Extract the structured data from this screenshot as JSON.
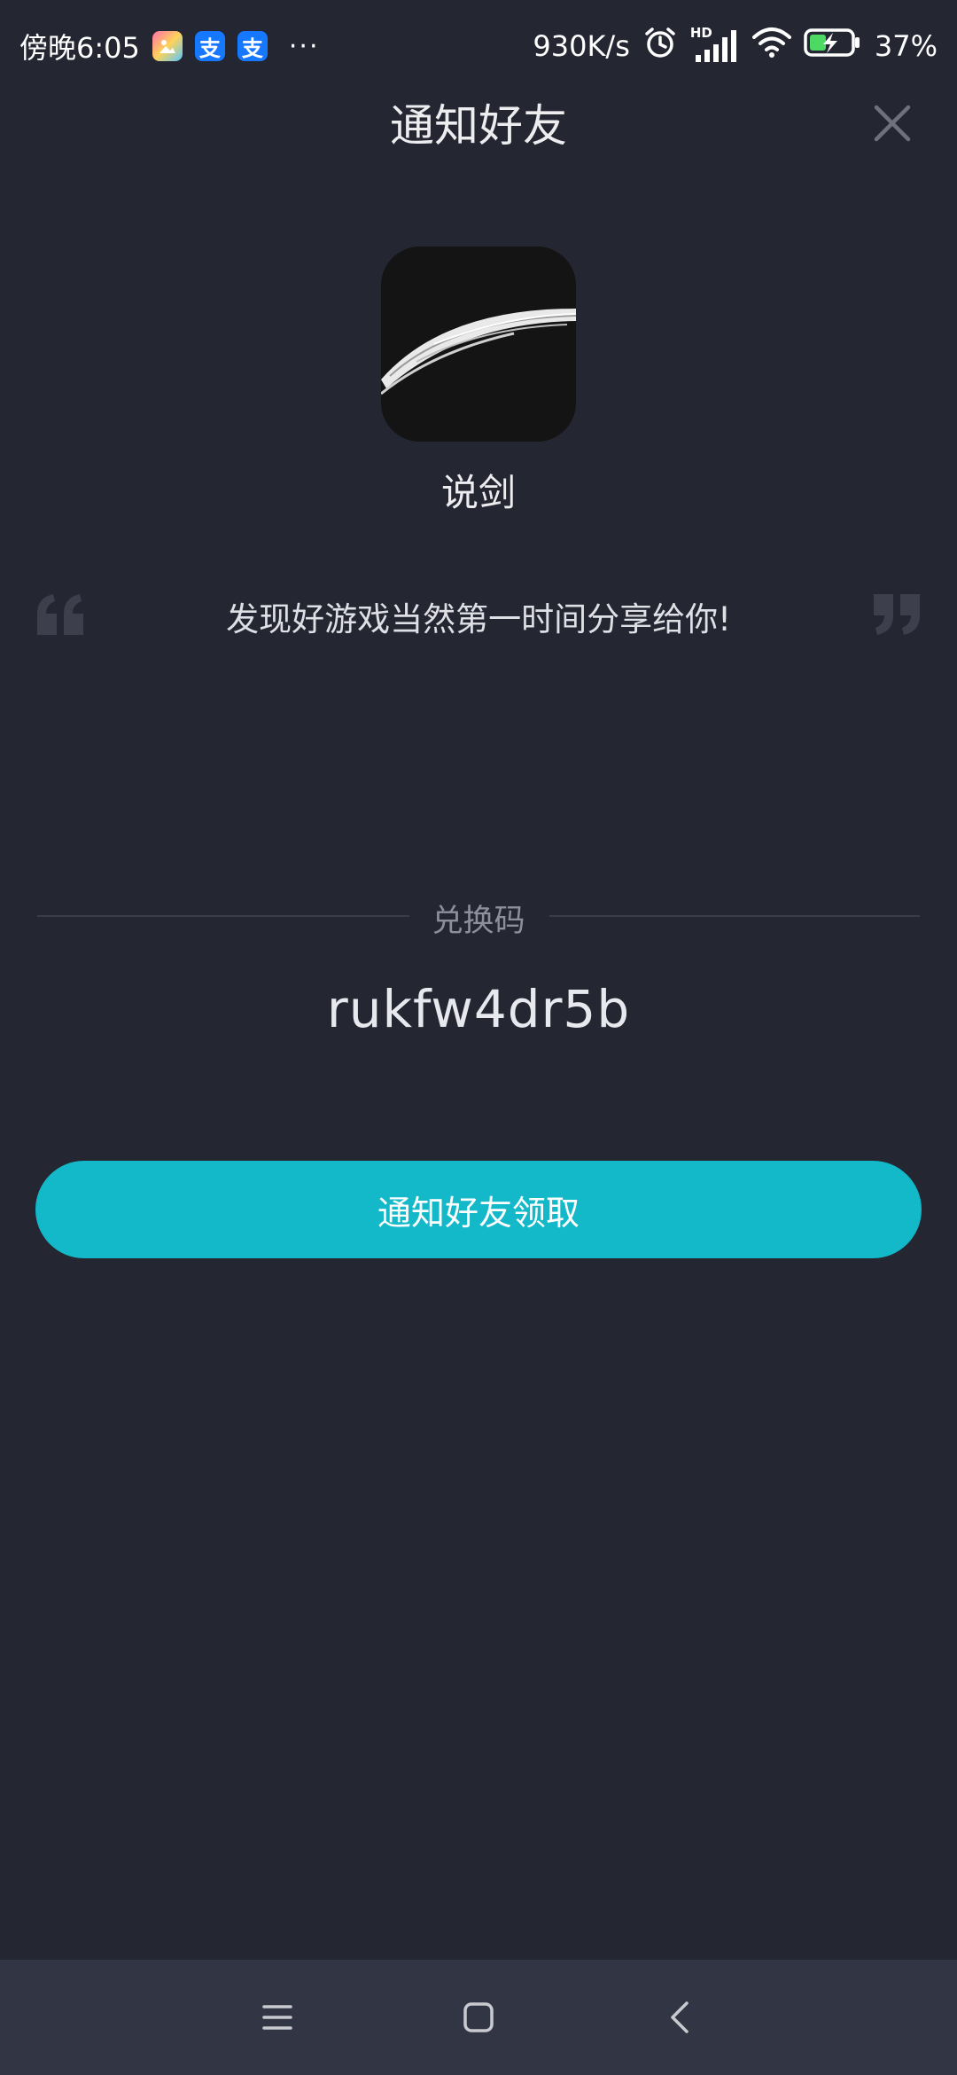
{
  "status_bar": {
    "time": "傍晚6:05",
    "alipay_glyph": "支",
    "more": "···",
    "speed": "930K/s",
    "network_badge": "HD",
    "battery": "37%",
    "icons": [
      "gallery-icon",
      "alipay-icon",
      "alipay-icon",
      "alarm-icon",
      "signal-icon",
      "wifi-icon",
      "battery-charging-icon"
    ]
  },
  "header": {
    "title": "通知好友",
    "close_icon": "close-icon"
  },
  "game": {
    "name": "说剑"
  },
  "quote": {
    "text": "发现好游戏当然第一时间分享给你!"
  },
  "code": {
    "label": "兑换码",
    "value": "rukfw4dr5b"
  },
  "action": {
    "button_label": "通知好友领取"
  },
  "colors": {
    "background": "#242632",
    "accent": "#13b9c8",
    "nav_bar": "#323543"
  },
  "nav": {
    "icons": [
      "menu-icon",
      "home-icon",
      "back-icon"
    ]
  }
}
